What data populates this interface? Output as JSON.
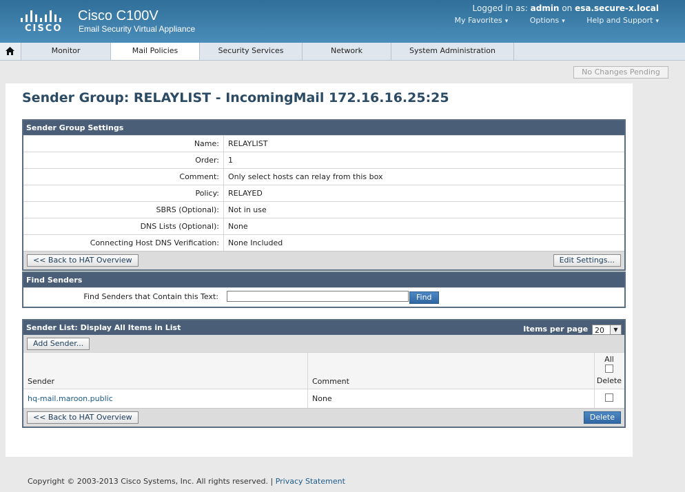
{
  "brand": {
    "logo_text": "CISCO",
    "product": "Cisco C100V",
    "subtitle": "Email Security Virtual Appliance"
  },
  "user": {
    "prefix": "Logged in as:",
    "name": "admin",
    "on": "on",
    "host": "esa.secure-x.local"
  },
  "top_links": [
    "My Favorites",
    "Options",
    "Help and Support"
  ],
  "nav": {
    "tabs": [
      "Monitor",
      "Mail Policies",
      "Security Services",
      "Network",
      "System Administration"
    ],
    "active": "Mail Policies"
  },
  "pending_label": "No Changes Pending",
  "page_title": "Sender Group: RELAYLIST - IncomingMail 172.16.16.25:25",
  "settings": {
    "header": "Sender Group Settings",
    "rows": [
      {
        "label": "Name:",
        "value": "RELAYLIST"
      },
      {
        "label": "Order:",
        "value": "1"
      },
      {
        "label": "Comment:",
        "value": "Only select hosts can relay from this box"
      },
      {
        "label": "Policy:",
        "value": "RELAYED"
      },
      {
        "label": "SBRS (Optional):",
        "value": "Not in use"
      },
      {
        "label": "DNS Lists (Optional):",
        "value": "None"
      },
      {
        "label": "Connecting Host DNS Verification:",
        "value": "None Included"
      }
    ],
    "back_button": "<< Back to HAT Overview",
    "edit_button": "Edit Settings..."
  },
  "find": {
    "header": "Find Senders",
    "label": "Find Senders that Contain this Text:",
    "value": "",
    "button": "Find"
  },
  "sender_list": {
    "header": "Sender List: Display All Items in List",
    "ipp_label": "Items per page",
    "ipp_value": "20",
    "add_button": "Add Sender...",
    "col_sender": "Sender",
    "col_comment": "Comment",
    "col_all": "All",
    "col_delete": "Delete",
    "rows": [
      {
        "sender": "hq-mail.maroon.public",
        "comment": "None"
      }
    ],
    "back_button": "<< Back to HAT Overview",
    "delete_button": "Delete"
  },
  "footer": {
    "copyright": "Copyright © 2003-2013 Cisco Systems, Inc. All rights reserved. |",
    "privacy": "Privacy Statement"
  }
}
